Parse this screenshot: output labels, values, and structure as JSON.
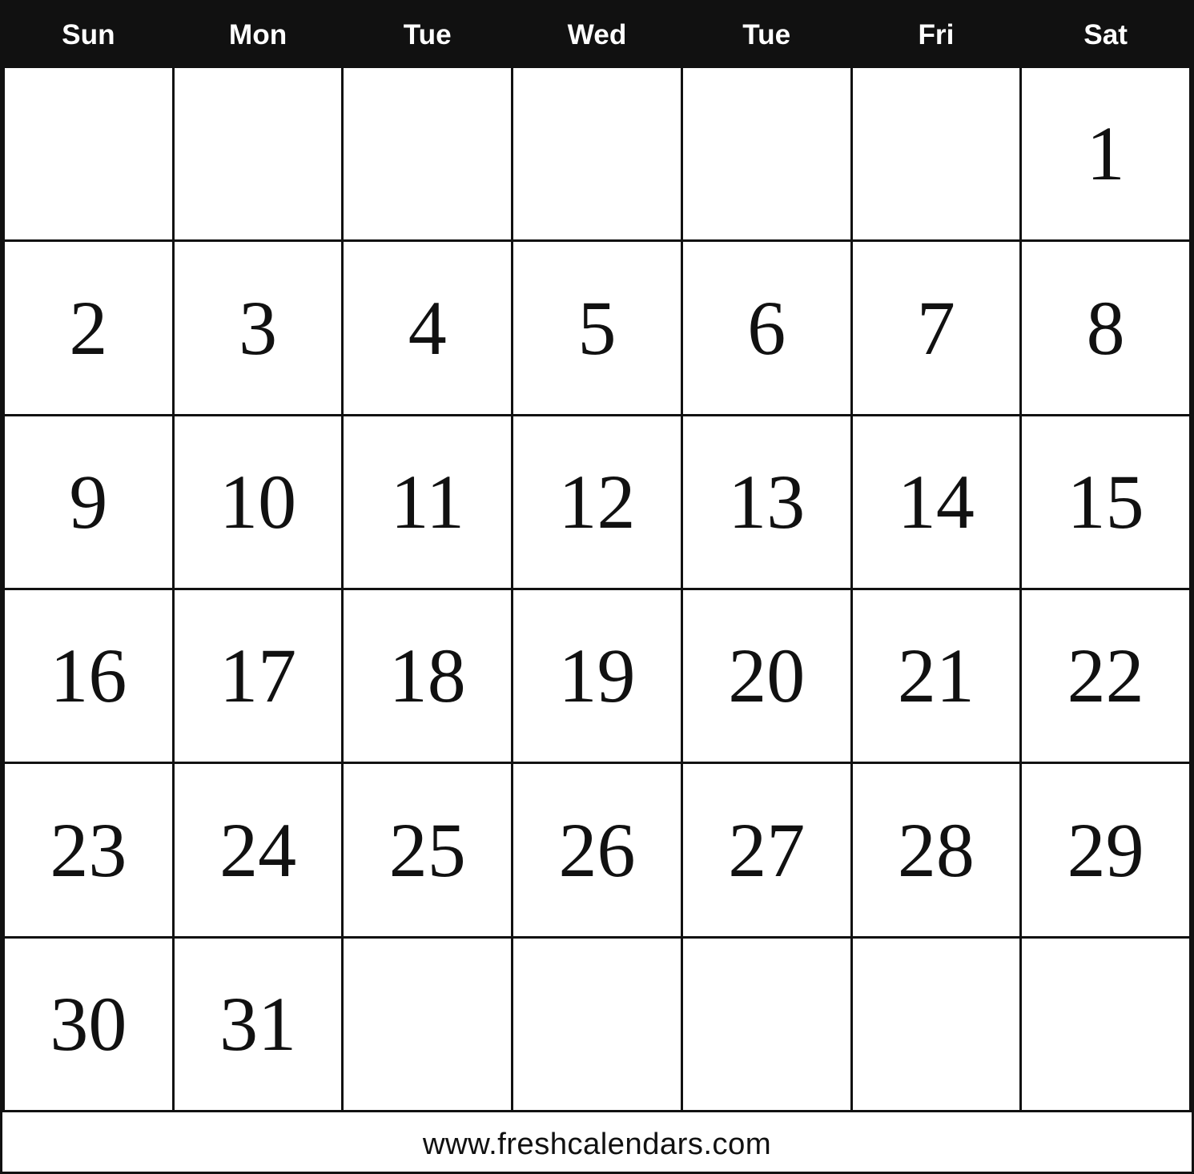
{
  "header": {
    "days": [
      "Sun",
      "Mon",
      "Tue",
      "Wed",
      "Tue",
      "Fri",
      "Sat"
    ]
  },
  "weeks": [
    [
      {
        "day": "",
        "empty": true
      },
      {
        "day": "",
        "empty": true
      },
      {
        "day": "",
        "empty": true
      },
      {
        "day": "",
        "empty": true
      },
      {
        "day": "",
        "empty": true
      },
      {
        "day": "",
        "empty": true
      },
      {
        "day": "1",
        "empty": false
      }
    ],
    [
      {
        "day": "2",
        "empty": false
      },
      {
        "day": "3",
        "empty": false
      },
      {
        "day": "4",
        "empty": false
      },
      {
        "day": "5",
        "empty": false
      },
      {
        "day": "6",
        "empty": false
      },
      {
        "day": "7",
        "empty": false
      },
      {
        "day": "8",
        "empty": false
      }
    ],
    [
      {
        "day": "9",
        "empty": false
      },
      {
        "day": "10",
        "empty": false
      },
      {
        "day": "11",
        "empty": false
      },
      {
        "day": "12",
        "empty": false
      },
      {
        "day": "13",
        "empty": false
      },
      {
        "day": "14",
        "empty": false
      },
      {
        "day": "15",
        "empty": false
      }
    ],
    [
      {
        "day": "16",
        "empty": false
      },
      {
        "day": "17",
        "empty": false
      },
      {
        "day": "18",
        "empty": false
      },
      {
        "day": "19",
        "empty": false
      },
      {
        "day": "20",
        "empty": false
      },
      {
        "day": "21",
        "empty": false
      },
      {
        "day": "22",
        "empty": false
      }
    ],
    [
      {
        "day": "23",
        "empty": false
      },
      {
        "day": "24",
        "empty": false
      },
      {
        "day": "25",
        "empty": false
      },
      {
        "day": "26",
        "empty": false
      },
      {
        "day": "27",
        "empty": false
      },
      {
        "day": "28",
        "empty": false
      },
      {
        "day": "29",
        "empty": false
      }
    ],
    [
      {
        "day": "30",
        "empty": false
      },
      {
        "day": "31",
        "empty": false
      },
      {
        "day": "",
        "empty": true
      },
      {
        "day": "",
        "empty": true
      },
      {
        "day": "",
        "empty": true
      },
      {
        "day": "",
        "empty": true
      },
      {
        "day": "",
        "empty": true
      }
    ]
  ],
  "footer": {
    "text": "www.freshcalendars.com"
  }
}
